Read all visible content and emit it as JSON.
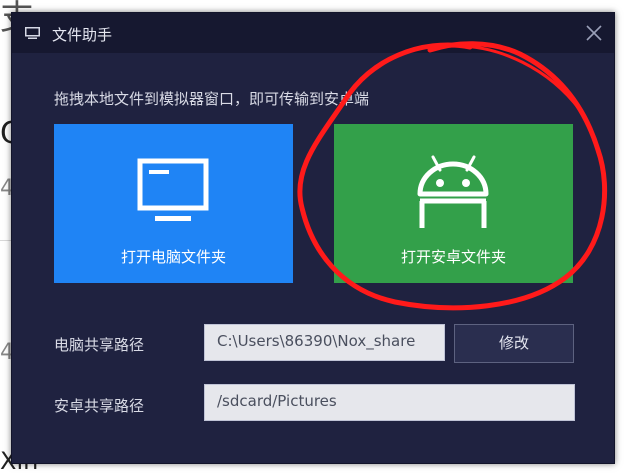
{
  "background": {
    "fragments": [
      "支",
      "C",
      "4",
      "4",
      "Xin"
    ]
  },
  "dialog": {
    "title": "文件助手",
    "title_icon": "monitor-icon",
    "close_icon": "close-icon",
    "hint": "拖拽本地文件到模拟器窗口，即可传输到安卓端",
    "tiles": {
      "pc": {
        "label": "打开电脑文件夹",
        "icon": "monitor-icon",
        "color": "#1f84f5"
      },
      "android": {
        "label": "打开安卓文件夹",
        "icon": "android-icon",
        "color": "#33a04a"
      }
    },
    "pc_path": {
      "label": "电脑共享路径",
      "value": "C:\\Users\\86390\\Nox_share",
      "button": "修改"
    },
    "android_path": {
      "label": "安卓共享路径",
      "value": "/sdcard/Pictures"
    }
  },
  "annotation": {
    "color": "#ff1a1a",
    "shape": "hand-drawn-circle"
  }
}
